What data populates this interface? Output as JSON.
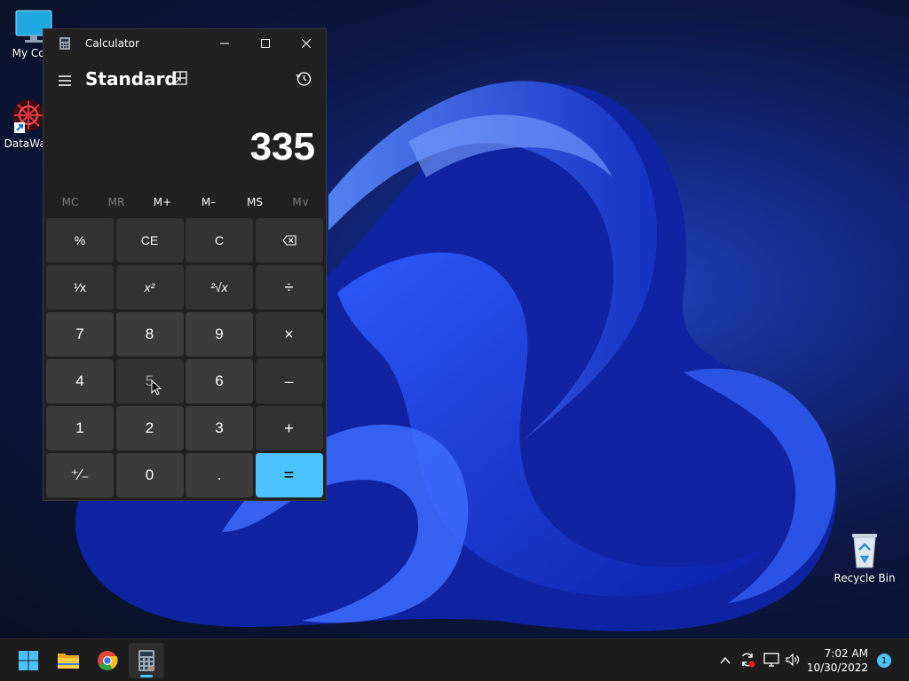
{
  "desktop": {
    "icons": [
      {
        "label": "My Com"
      },
      {
        "label": "DataWag"
      },
      {
        "label": "Recycle Bin"
      }
    ]
  },
  "calculator": {
    "title": "Calculator",
    "mode": "Standard",
    "display_value": "335",
    "memory": [
      "MC",
      "MR",
      "M+",
      "M–",
      "MS",
      "M∨"
    ],
    "keys": {
      "percent": "%",
      "ce": "CE",
      "clear": "C",
      "reciprocal": "¹∕x",
      "square": "x²",
      "sqrt": "²√x",
      "divide": "÷",
      "seven": "7",
      "eight": "8",
      "nine": "9",
      "multiply": "×",
      "four": "4",
      "five": "5",
      "six": "6",
      "minus": "–",
      "one": "1",
      "two": "2",
      "three": "3",
      "plus": "+",
      "negate": "⁺∕₋",
      "zero": "0",
      "decimal": ".",
      "equals": "="
    }
  },
  "taskbar": {
    "time": "7:02 AM",
    "date": "10/30/2022",
    "notification_count": "1"
  },
  "colors": {
    "accent": "#4cc2ff",
    "window_bg": "#202020",
    "number_key": "#3b3b3b",
    "function_key": "#323232"
  }
}
